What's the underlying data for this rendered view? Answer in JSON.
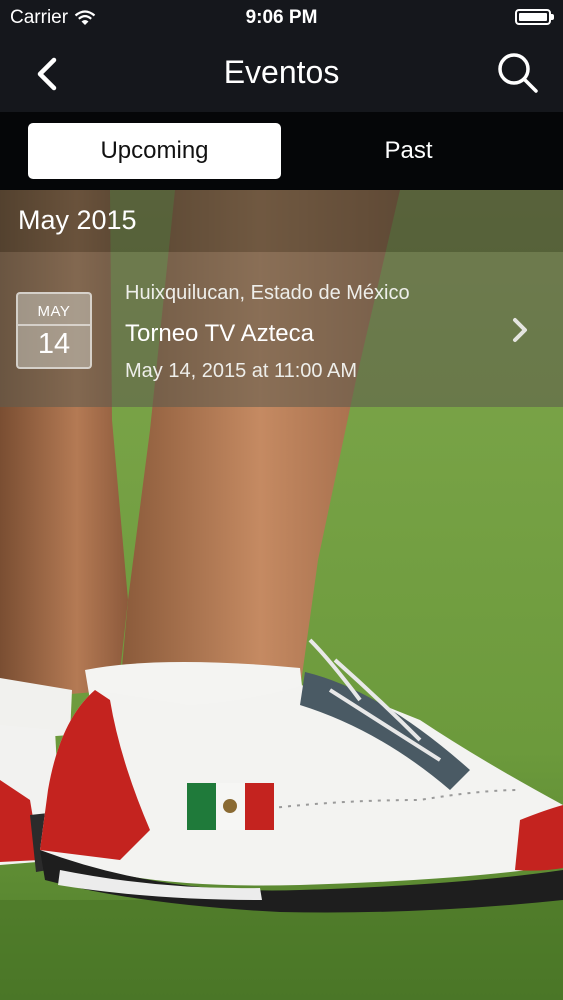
{
  "status_bar": {
    "carrier": "Carrier",
    "time": "9:06 PM",
    "icons": [
      "wifi-icon",
      "battery-icon"
    ]
  },
  "nav": {
    "title": "Eventos",
    "left_icon": "back-chevron-icon",
    "right_icon": "search-icon"
  },
  "tabs": [
    {
      "label": "Upcoming",
      "selected": true
    },
    {
      "label": "Past",
      "selected": false
    }
  ],
  "section": {
    "title": "May 2015"
  },
  "events": [
    {
      "month": "MAY",
      "day": "14",
      "location": "Huixquilucan, Estado de México",
      "name": "Torneo TV Azteca",
      "datetime": "May 14, 2015 at 11:00 AM"
    }
  ],
  "colors": {
    "nav_background": "#15171c",
    "segment_background": "#050608",
    "segment_selected": "#ffffff",
    "grass": "#6c9a3c",
    "shoe_red": "#c4231f"
  }
}
